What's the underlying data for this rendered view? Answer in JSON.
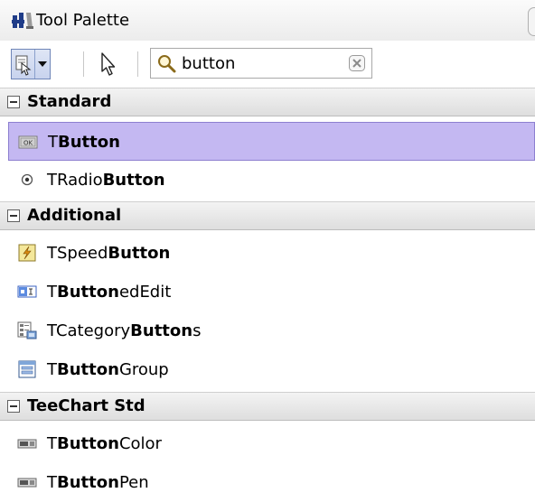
{
  "window": {
    "title": "Tool Palette"
  },
  "search": {
    "value": "button",
    "placeholder": ""
  },
  "icons": {
    "app": "tool-palette-icon",
    "components": "components-icon",
    "dropdown": "chevron-down-icon",
    "cursor": "arrow-cursor-icon",
    "search": "magnifier-icon",
    "clear": "clear-search-icon"
  },
  "colors": {
    "selection_bg": "#c4b8f2",
    "selection_border": "#8d7fd0",
    "header_bg": "#e4e4e4"
  },
  "categories": [
    {
      "label": "Standard",
      "items": [
        {
          "prefix": "T",
          "match": "Button",
          "suffix": "",
          "icon": "button-component-icon",
          "selected": true
        },
        {
          "prefix": "TRadio",
          "match": "Button",
          "suffix": "",
          "icon": "radio-button-icon",
          "selected": false
        }
      ]
    },
    {
      "label": "Additional",
      "items": [
        {
          "prefix": "TSpeed",
          "match": "Button",
          "suffix": "",
          "icon": "speed-button-icon",
          "selected": false
        },
        {
          "prefix": "T",
          "match": "Button",
          "suffix": "edEdit",
          "icon": "buttoned-edit-icon",
          "selected": false
        },
        {
          "prefix": "TCategory",
          "match": "Button",
          "suffix": "s",
          "icon": "category-buttons-icon",
          "selected": false
        },
        {
          "prefix": "T",
          "match": "Button",
          "suffix": "Group",
          "icon": "button-group-icon",
          "selected": false
        }
      ]
    },
    {
      "label": "TeeChart Std",
      "items": [
        {
          "prefix": "T",
          "match": "Button",
          "suffix": "Color",
          "icon": "button-color-icon",
          "selected": false
        },
        {
          "prefix": "T",
          "match": "Button",
          "suffix": "Pen",
          "icon": "button-pen-icon",
          "selected": false
        }
      ]
    }
  ]
}
